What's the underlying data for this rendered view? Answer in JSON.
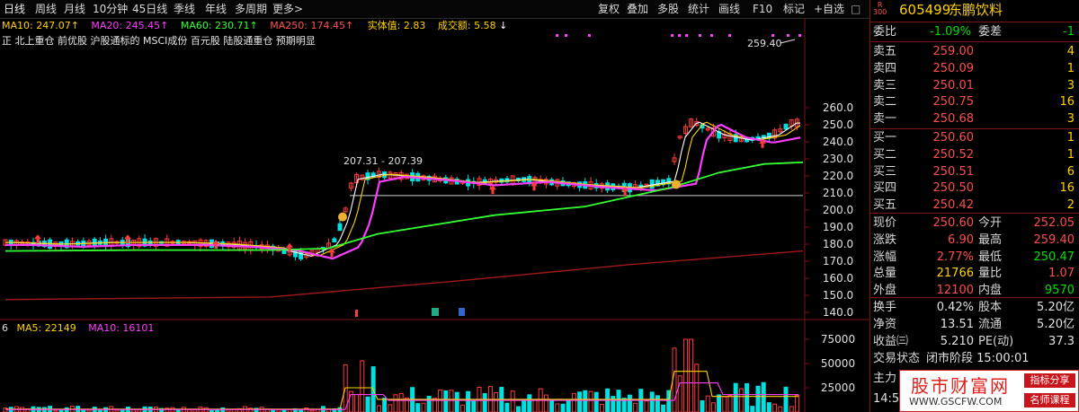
{
  "toolbar": {
    "left": [
      "日线",
      "周线",
      "月线",
      "10分钟",
      "45日线",
      "季线",
      "年线",
      "多周期",
      "更多"
    ],
    "right": [
      "复权",
      "叠加",
      "多股",
      "统计",
      "画线",
      "F10",
      "标记",
      "+自选"
    ]
  },
  "legend": {
    "ma10": "MA10: 247.07↑",
    "ma20": "MA20: 245.45↑",
    "ma60": "MA60: 230.71↑",
    "ma250": "MA250: 174.45↑",
    "shiji": "实体值: 2.83",
    "chengjiao": "成交额: 5.58",
    "arrow": "↓",
    "tags": "正 北上重仓 前优股 沪股通标的 MSCI成份 百元股 陆股通重仓 预期明显"
  },
  "price_axis": [
    "260.0",
    "250.0",
    "240.0",
    "230.0",
    "220.0",
    "210.0",
    "200.0",
    "190.0",
    "180.0",
    "170.0",
    "160.0",
    "150.0",
    "140.0"
  ],
  "annotations": {
    "high_label": "259.40",
    "low_label": "207.31 - 207.39"
  },
  "volume": {
    "ma5": "MA5: 22149",
    "ma10": "MA10: 16101",
    "prefix": "6",
    "axis": [
      "75000",
      "50000",
      "25000"
    ]
  },
  "stock": {
    "code": "605499",
    "name": "东鹏饮料",
    "badge_top": "R",
    "badge_bottom": "300"
  },
  "order": {
    "weibi_label": "委比",
    "weibi": "-1.09%",
    "weicha_label": "委差",
    "weicha": "-1",
    "sell": [
      {
        "label": "卖五",
        "price": "259.00",
        "vol": "4"
      },
      {
        "label": "卖四",
        "price": "250.09",
        "vol": "1"
      },
      {
        "label": "卖三",
        "price": "250.01",
        "vol": "3"
      },
      {
        "label": "卖二",
        "price": "250.75",
        "vol": "16"
      },
      {
        "label": "卖一",
        "price": "250.68",
        "vol": "3"
      }
    ],
    "buy": [
      {
        "label": "买一",
        "price": "250.60",
        "vol": "1"
      },
      {
        "label": "买二",
        "price": "250.52",
        "vol": "1"
      },
      {
        "label": "买三",
        "price": "250.51",
        "vol": "6"
      },
      {
        "label": "买四",
        "price": "250.50",
        "vol": "16"
      },
      {
        "label": "买五",
        "price": "250.42",
        "vol": "2"
      }
    ]
  },
  "quote": [
    {
      "l1": "现价",
      "v1": "250.60",
      "c1": "red",
      "l2": "今开",
      "v2": "252.05",
      "c2": "red"
    },
    {
      "l1": "涨跌",
      "v1": "6.90",
      "c1": "red",
      "l2": "最高",
      "v2": "259.40",
      "c2": "red"
    },
    {
      "l1": "涨幅",
      "v1": "2.77%",
      "c1": "red",
      "l2": "最低",
      "v2": "250.47",
      "c2": "green"
    },
    {
      "l1": "总量",
      "v1": "21766",
      "c1": "yellow",
      "l2": "量比",
      "v2": "1.07",
      "c2": "red"
    },
    {
      "l1": "外盘",
      "v1": "12100",
      "c1": "red",
      "l2": "内盘",
      "v2": "9570",
      "c2": "green"
    }
  ],
  "fund": [
    {
      "l1": "换手",
      "v1": "0.42%",
      "l2": "股本",
      "v2": "5.20亿"
    },
    {
      "l1": "净资",
      "v1": "13.51",
      "l2": "流通",
      "v2": "5.20亿"
    },
    {
      "l1": "收益㈢",
      "v1": "5.210",
      "l2": "PE(动)",
      "v2": "37.3"
    }
  ],
  "bottom": {
    "status_label": "交易状态",
    "status_value": "闭市阶段 15:00:01",
    "main_label": "主力",
    "time_label": "14:5"
  },
  "watermark": {
    "title": "股市财富网",
    "url": "WWW.GSCFW.COM",
    "tag1": "指标分享",
    "tag2": "名师课程"
  },
  "colors": {
    "up": "#ff3b3b",
    "down": "#00e0e0",
    "ma5": "#ffffff",
    "ma10": "#ffd200",
    "ma20": "#ff3dff",
    "ma60": "#33ff33",
    "ma250": "#a01818"
  }
}
